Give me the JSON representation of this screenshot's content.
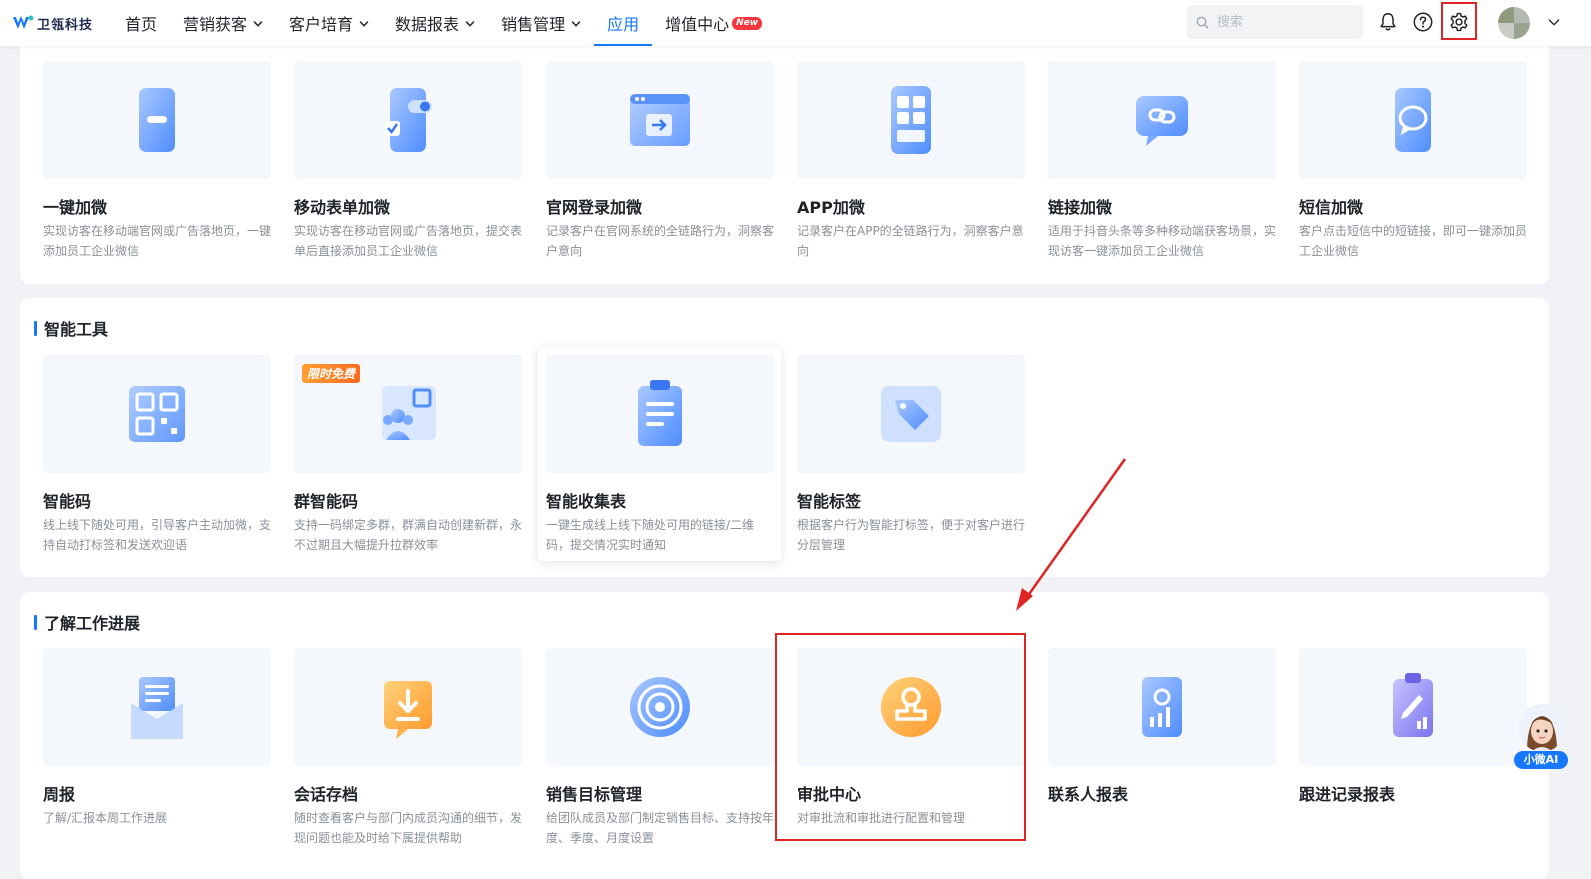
{
  "brand": {
    "name": "卫瓴科技"
  },
  "nav": {
    "items": [
      {
        "label": "首页",
        "dropdown": false,
        "active": false
      },
      {
        "label": "营销获客",
        "dropdown": true,
        "active": false
      },
      {
        "label": "客户培育",
        "dropdown": true,
        "active": false
      },
      {
        "label": "数据报表",
        "dropdown": true,
        "active": false
      },
      {
        "label": "销售管理",
        "dropdown": true,
        "active": false
      },
      {
        "label": "应用",
        "dropdown": false,
        "active": true
      },
      {
        "label": "增值中心",
        "dropdown": false,
        "active": false,
        "badge": "New"
      }
    ]
  },
  "search": {
    "placeholder": "搜索",
    "value": ""
  },
  "toolbar": {
    "icons": [
      "bell-icon",
      "help-icon",
      "gear-icon",
      "avatar",
      "chevron-down-icon"
    ]
  },
  "colors": {
    "accent": "#1677ff",
    "highlight": "#e02424",
    "badge": "#f5383e"
  },
  "sections": [
    {
      "title": "",
      "cards": [
        {
          "name": "一键加微",
          "desc": "实现访客在移动端官网或广告落地页，一键添加员工企业微信",
          "icon": "phone-minus-icon"
        },
        {
          "name": "移动表单加微",
          "desc": "实现访客在移动官网或广告落地页，提交表单后直接添加员工企业微信",
          "icon": "phone-toggle-icon"
        },
        {
          "name": "官网登录加微",
          "desc": "记录客户在官网系统的全链路行为，洞察客户意向",
          "icon": "browser-login-icon"
        },
        {
          "name": "APP加微",
          "desc": "记录客户在APP的全链路行为，洞察客户意向",
          "icon": "app-grid-icon"
        },
        {
          "name": "链接加微",
          "desc": "适用于抖音头条等多种移动端获客场景，实现访客一键添加员工企业微信",
          "icon": "link-chat-icon"
        },
        {
          "name": "短信加微",
          "desc": "客户点击短信中的短链接，即可一键添加员工企业微信",
          "icon": "sms-bubble-icon"
        }
      ]
    },
    {
      "title": "智能工具",
      "cards": [
        {
          "name": "智能码",
          "desc": "线上线下随处可用，引导客户主动加微，支持自动打标签和发送欢迎语",
          "icon": "qr-code-icon"
        },
        {
          "name": "群智能码",
          "desc": "支持一码绑定多群，群满自动创建新群，永不过期且大幅提升拉群效率",
          "icon": "group-qr-icon",
          "tag": "限时免费"
        },
        {
          "name": "智能收集表",
          "desc": "一键生成线上线下随处可用的链接/二维码，提交情况实时通知",
          "icon": "clipboard-form-icon"
        },
        {
          "name": "智能标签",
          "desc": "根据客户行为智能打标签，便于对客户进行分层管理",
          "icon": "tag-icon"
        }
      ]
    },
    {
      "title": "了解工作进展",
      "cards": [
        {
          "name": "周报",
          "desc": "了解/汇报本周工作进展",
          "icon": "report-envelope-icon"
        },
        {
          "name": "会话存档",
          "desc": "随时查看客户与部门内成员沟通的细节，发现问题也能及时给下属提供帮助",
          "icon": "archive-download-icon"
        },
        {
          "name": "销售目标管理",
          "desc": "给团队成员及部门制定销售目标、支持按年度、季度、月度设置",
          "icon": "target-icon"
        },
        {
          "name": "审批中心",
          "desc": "对审批流和审批进行配置和管理",
          "icon": "approval-stamp-icon"
        },
        {
          "name": "联系人报表",
          "desc": "",
          "icon": "contact-report-icon"
        },
        {
          "name": "跟进记录报表",
          "desc": "",
          "icon": "followup-report-icon"
        }
      ]
    }
  ],
  "assistant": {
    "label": "小微AI"
  }
}
